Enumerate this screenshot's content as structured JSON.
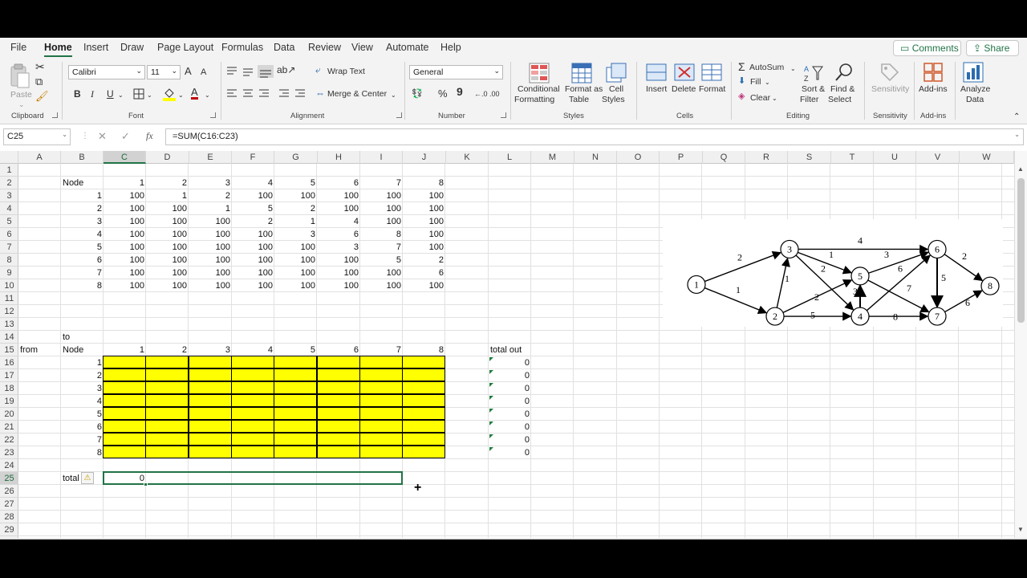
{
  "menu": {
    "tabs": [
      "File",
      "Home",
      "Insert",
      "Draw",
      "Page Layout",
      "Formulas",
      "Data",
      "Review",
      "View",
      "Automate",
      "Help"
    ],
    "active": "Home",
    "comments": "Comments",
    "share": "Share"
  },
  "ribbon": {
    "clipboard": {
      "paste": "Paste",
      "label": "Clipboard"
    },
    "font": {
      "name": "Calibri",
      "size": "11",
      "label": "Font",
      "bold": "B",
      "italic": "I",
      "underline": "U",
      "grow": "A",
      "shrink": "A",
      "color_a": "A"
    },
    "alignment": {
      "wrap": "Wrap Text",
      "merge": "Merge & Center",
      "label": "Alignment"
    },
    "number": {
      "format": "General",
      "percent": "%",
      "comma": "9",
      "inc": "←.0",
      "dec": ".00",
      "label": "Number"
    },
    "styles": {
      "conditional": "Conditional",
      "conditional2": "Formatting",
      "format_as": "Format as",
      "format_as2": "Table",
      "cell": "Cell",
      "cell2": "Styles",
      "label": "Styles"
    },
    "cells": {
      "insert": "Insert",
      "delete": "Delete",
      "format": "Format",
      "label": "Cells"
    },
    "editing": {
      "autosum": "AutoSum",
      "fill": "Fill",
      "clear": "Clear",
      "sort": "Sort &",
      "sort2": "Filter",
      "find": "Find &",
      "find2": "Select",
      "label": "Editing"
    },
    "sensitivity": {
      "btn": "Sensitivity",
      "label": "Sensitivity"
    },
    "addins": {
      "btn": "Add-ins",
      "label": "Add-ins"
    },
    "analyze": {
      "btn": "Analyze",
      "btn2": "Data"
    },
    "accent": "#217346"
  },
  "formula_bar": {
    "name_box": "C25",
    "fx": "fx",
    "formula": "=SUM(C16:C23)"
  },
  "columns": [
    "A",
    "B",
    "C",
    "D",
    "E",
    "F",
    "G",
    "H",
    "I",
    "J",
    "K",
    "L",
    "M",
    "N",
    "O",
    "P",
    "Q",
    "R",
    "S",
    "T",
    "U",
    "V",
    "W"
  ],
  "rows": [
    "1",
    "2",
    "3",
    "4",
    "5",
    "6",
    "7",
    "8",
    "9",
    "10",
    "11",
    "12",
    "13",
    "14",
    "15",
    "16",
    "17",
    "18",
    "19",
    "20",
    "21",
    "22",
    "23",
    "24",
    "25",
    "26",
    "27",
    "28",
    "29"
  ],
  "sheet": {
    "matrix_header_label": "Node",
    "matrix_header": [
      "1",
      "2",
      "3",
      "4",
      "5",
      "6",
      "7",
      "8"
    ],
    "matrix_rows": [
      {
        "node": "1",
        "values": [
          "100",
          "1",
          "2",
          "100",
          "100",
          "100",
          "100",
          "100"
        ]
      },
      {
        "node": "2",
        "values": [
          "100",
          "100",
          "1",
          "5",
          "2",
          "100",
          "100",
          "100"
        ]
      },
      {
        "node": "3",
        "values": [
          "100",
          "100",
          "100",
          "2",
          "1",
          "4",
          "100",
          "100"
        ]
      },
      {
        "node": "4",
        "values": [
          "100",
          "100",
          "100",
          "100",
          "3",
          "6",
          "8",
          "100"
        ]
      },
      {
        "node": "5",
        "values": [
          "100",
          "100",
          "100",
          "100",
          "100",
          "3",
          "7",
          "100"
        ]
      },
      {
        "node": "6",
        "values": [
          "100",
          "100",
          "100",
          "100",
          "100",
          "100",
          "5",
          "2"
        ]
      },
      {
        "node": "7",
        "values": [
          "100",
          "100",
          "100",
          "100",
          "100",
          "100",
          "100",
          "6"
        ]
      },
      {
        "node": "8",
        "values": [
          "100",
          "100",
          "100",
          "100",
          "100",
          "100",
          "100",
          "100"
        ]
      }
    ],
    "to_label": "to",
    "from_label": "from",
    "node_label": "Node",
    "flow_header": [
      "1",
      "2",
      "3",
      "4",
      "5",
      "6",
      "7",
      "8"
    ],
    "flow_nodes": [
      "1",
      "2",
      "3",
      "4",
      "5",
      "6",
      "7",
      "8"
    ],
    "total_out_label": "total out",
    "total_out": [
      "0",
      "0",
      "0",
      "0",
      "0",
      "0",
      "0",
      "0"
    ],
    "total_label": "total",
    "total_value": "0",
    "fill_color": "#ffff00"
  },
  "graph": {
    "nodes": [
      "1",
      "2",
      "3",
      "4",
      "5",
      "6",
      "7",
      "8"
    ],
    "edge_labels": [
      "2",
      "1",
      "1",
      "2",
      "5",
      "4",
      "1",
      "2",
      "3",
      "3",
      "6",
      "7",
      "8",
      "5",
      "2",
      "6"
    ]
  }
}
